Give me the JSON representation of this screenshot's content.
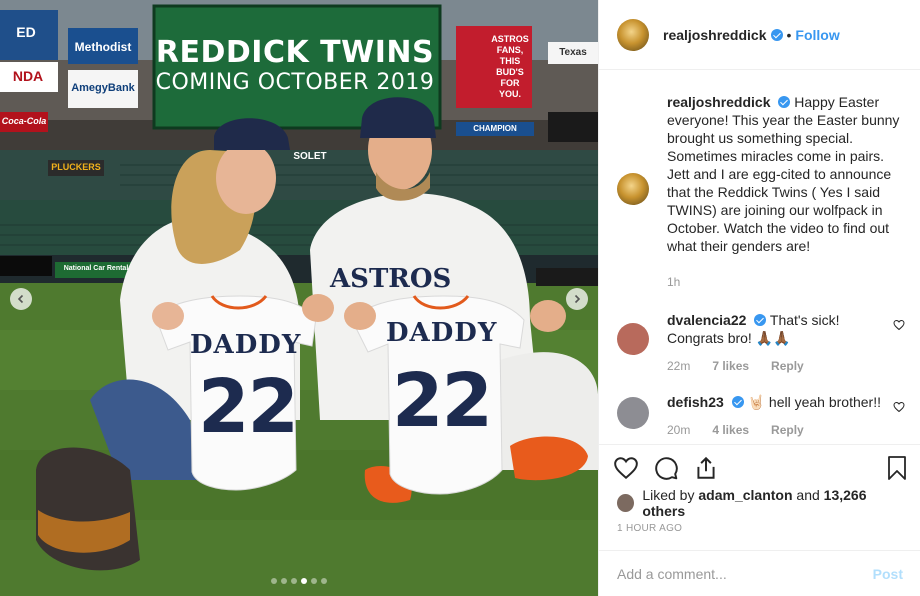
{
  "media": {
    "board_title": "REDDICK TWINS",
    "board_subtitle": "COMING OCTOBER 2019",
    "signs": {
      "methodist": "Methodist",
      "amegy": "AmegyBank",
      "budweiser": "ASTROS FANS, THIS BUD'S FOR YOU.",
      "texas": "Texas",
      "coca": "Coca-Cola",
      "pluckers": "PLUCKERS",
      "national": "National Car Rental",
      "champion": "CHAMPION",
      "left_top": "ED",
      "left_mid": "NDA",
      "solet": "SOLET"
    },
    "jersey_name": "DADDY",
    "jersey_number": "22",
    "astros_text": "ASTROS",
    "carousel_dots": 6,
    "active_dot": 3
  },
  "post": {
    "username": "realjoshreddick",
    "separator": "•",
    "follow_label": "Follow",
    "caption_user": "realjoshreddick",
    "caption_text": "Happy Easter everyone! This year the Easter bunny brought us something special. Sometimes miracles come in pairs. Jett and I are egg-cited to announce that the Reddick Twins ( Yes I said TWINS) are joining our wolfpack in October. Watch the video to find out what their genders are!",
    "caption_time": "1h",
    "comments": [
      {
        "user": "dvalencia22",
        "text": "That's sick! Congrats bro! 🙏🏾🙏🏾",
        "time": "22m",
        "likes": "7 likes",
        "reply": "Reply",
        "avatar_color": "#b86a5c"
      },
      {
        "user": "defish23",
        "text": "🤘🏻 hell yeah brother!!",
        "time": "20m",
        "likes": "4 likes",
        "reply": "Reply",
        "avatar_color": "#8d8d93"
      }
    ],
    "liked_by_prefix": "Liked by",
    "liked_by_user": "adam_clanton",
    "liked_by_and": "and",
    "liked_by_others": "13,266 others",
    "time_ago": "1 HOUR AGO",
    "comment_placeholder": "Add a comment...",
    "post_label": "Post"
  },
  "colors": {
    "accent": "#3897f0",
    "post_disabled": "#b2dffc",
    "muted": "#999999"
  },
  "icons": [
    "heart-icon",
    "comment-icon",
    "share-icon",
    "bookmark-icon",
    "verified-badge-icon",
    "chevron-left-icon",
    "chevron-right-icon"
  ]
}
